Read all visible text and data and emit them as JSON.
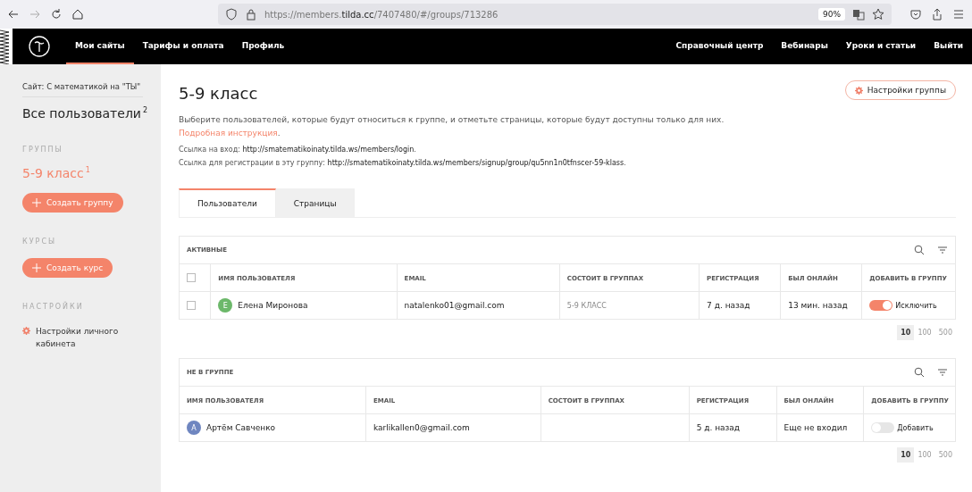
{
  "browser": {
    "url_prefix": "https://members.",
    "url_host": "tilda.cc",
    "url_path": "/7407480/#/groups/713286",
    "zoom": "90%"
  },
  "nav": {
    "left": [
      {
        "label": "Мои сайты",
        "selected": true
      },
      {
        "label": "Тарифы и оплата",
        "selected": false
      },
      {
        "label": "Профиль",
        "selected": false
      }
    ],
    "right": [
      "Справочный центр",
      "Вебинары",
      "Уроки и статьи",
      "Выйти"
    ]
  },
  "sidebar": {
    "site": "Сайт: С математикой на \"ТЫ\"",
    "all_users": "Все пользователи",
    "all_users_count": "2",
    "groups_heading": "ГРУППЫ",
    "groups": [
      {
        "label": "5-9 класс",
        "count": "1",
        "selected": true
      }
    ],
    "create_group": "Создать группу",
    "courses_heading": "КУРСЫ",
    "create_course": "Создать курс",
    "settings_heading": "НАСТРОЙКИ",
    "settings_link": "Настройки личного кабинета"
  },
  "main": {
    "title": "5-9 класс",
    "settings_button": "Настройки группы",
    "description": "Выберите пользователей, которые будут относиться к группе, и отметьте страницы, которые будут доступны только для них.",
    "description_link": "Подробная инструкция",
    "description_end": ".",
    "login_label": "Ссылка на вход:",
    "login_url": "http://smatematikoinaty.tilda.ws/members/login",
    "login_end": ".",
    "signup_label": "Ссылка для регистрации в эту группу:",
    "signup_url": "http://smatematikoinaty.tilda.ws/members/signup/group/qu5nn1n0tfnscer-59-klass",
    "signup_end": ".",
    "tabs": [
      {
        "label": "Пользователи",
        "selected": true
      },
      {
        "label": "Страницы",
        "selected": false
      }
    ],
    "tables": [
      {
        "title": "АКТИВНЫЕ",
        "has_checkboxes": true,
        "header_checked": false,
        "columns": [
          "ИМЯ ПОЛЬЗОВАТЕЛЯ",
          "EMAIL",
          "СОСТОИТ В ГРУППАХ",
          "РЕГИСТРАЦИЯ",
          "БЫЛ ОНЛАЙН",
          "ДОБАВИТЬ В ГРУППУ"
        ],
        "rows": [
          {
            "checked": false,
            "initial": "Е",
            "color": "#6cb86a",
            "name": "Елена Миронова",
            "email": "natalenko01@gmail.com",
            "groups": "5-9 КЛАСС",
            "registered": "7 д. назад",
            "online": "13 мин. назад",
            "on": true,
            "action": "Исключить"
          }
        ],
        "page_sizes": [
          {
            "label": "10",
            "selected": true
          },
          {
            "label": "100",
            "selected": false
          },
          {
            "label": "500",
            "selected": false
          }
        ]
      },
      {
        "title": "НЕ В ГРУППЕ",
        "has_checkboxes": false,
        "columns": [
          "ИМЯ ПОЛЬЗОВАТЕЛЯ",
          "EMAIL",
          "СОСТОИТ В ГРУППАХ",
          "РЕГИСТРАЦИЯ",
          "БЫЛ ОНЛАЙН",
          "ДОБАВИТЬ В ГРУППУ"
        ],
        "rows": [
          {
            "initial": "А",
            "color": "#6f86c0",
            "name": "Артём Савченко",
            "email": "karlikallen0@gmail.com",
            "groups": "",
            "registered": "5 д. назад",
            "online": "Еще не входил",
            "on": false,
            "action": "Добавить"
          }
        ],
        "page_sizes": [
          {
            "label": "10",
            "selected": true
          },
          {
            "label": "100",
            "selected": false
          },
          {
            "label": "500",
            "selected": false
          }
        ]
      }
    ]
  }
}
